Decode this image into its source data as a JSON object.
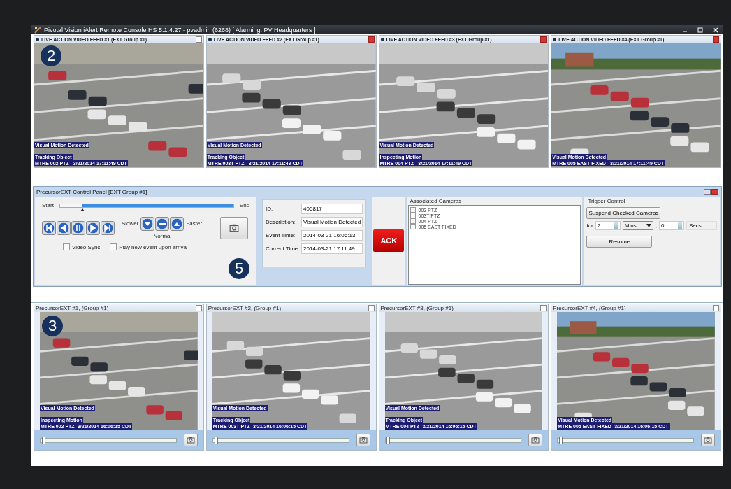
{
  "window": {
    "title": "Pivotal Vision iAlert Remote Console HS 5.1.4.27 - pvadmin (6268)  [ Alarming: PV Headquarters ]"
  },
  "live_feeds": {
    "badge": "2",
    "feeds": [
      {
        "title": "LIVE ACTION VIDEO FEED #1 (EXT Group #1)",
        "lines": [
          "Visual Motion Detected",
          "Tracking Object",
          "MTRE 002 PTZ - 3/21/2014 17:11:49 CDT"
        ]
      },
      {
        "title": "LIVE ACTION VIDEO FEED #2 (EXT Group #1)",
        "lines": [
          "Visual Motion Detected",
          "Tracking Object",
          "MTRE 003T PTZ - 3/21/2014 17:11:49 CDT"
        ]
      },
      {
        "title": "LIVE ACTION VIDEO FEED #3 (EXT Group #1)",
        "lines": [
          "Visual Motion Detected",
          "Inspecting Motion",
          "MTRE 004 PTZ - 3/21/2014 17:11:49 CDT"
        ]
      },
      {
        "title": "LIVE ACTION VIDEO FEED #4 (EXT Group #1)",
        "lines": [
          "Visual Motion Detected",
          "MTRE 005 EAST FIXED - 3/21/2014 17:11:49 CDT"
        ]
      }
    ]
  },
  "control_panel": {
    "title": "PrecursorEXT Control Panel [EXT Group #1]",
    "badge": "5",
    "timeline": {
      "start": "Start",
      "end": "End",
      "level": 0.13
    },
    "speed": {
      "slower": "Slower",
      "faster": "Faster",
      "normal": "Normal"
    },
    "options": [
      {
        "label": "Video Sync",
        "checked": false
      },
      {
        "label": "Play new event upon arrival",
        "checked": false
      }
    ],
    "event": [
      {
        "label": "ID:",
        "value": "405817"
      },
      {
        "label": "Description:",
        "value": "Visual Motion Detected"
      },
      {
        "label": "Event Time:",
        "value": "2014-03-21 16:06:13"
      },
      {
        "label": "Current Time:",
        "value": "2014-03-21 17:11:49"
      }
    ],
    "ack": "ACK",
    "associated_cameras": {
      "label": "Associated Cameras",
      "items": [
        {
          "label": "002 PTZ",
          "checked": false
        },
        {
          "label": "003T PTZ",
          "checked": false
        },
        {
          "label": "004 PTZ",
          "checked": false
        },
        {
          "label": "005 EAST FIXED",
          "checked": false
        }
      ]
    },
    "trigger": {
      "label": "Trigger Control",
      "suspend": "Suspend Checked Cameras",
      "for": "for",
      "minutes": "2",
      "unit": "Mins",
      "comma": ",",
      "seconds": "0",
      "seconds_unit": "Secs",
      "resume": "Resume"
    }
  },
  "precursor_feeds": {
    "badge": "3",
    "feeds": [
      {
        "title": "PrecursorEXT #1, (Group #1)",
        "lines": [
          "Visual Motion Detected",
          "Inspecting Motion",
          "MTRE 002 PTZ -3/21/2014 16:06:15 CDT"
        ],
        "level": 0.01
      },
      {
        "title": "PrecursorEXT #2, (Group #1)",
        "lines": [
          "Visual Motion Detected",
          "Tracking Object",
          "MTRE 003T PTZ -3/21/2014 16:06:15 CDT"
        ],
        "level": 0.01
      },
      {
        "title": "PrecursorEXT #3, (Group #1)",
        "lines": [
          "Visual Motion Detected",
          "Tracking Object",
          "MTRE 004 PTZ -3/21/2014 16:06:15 CDT"
        ],
        "level": 0.01
      },
      {
        "title": "PrecursorEXT #4, (Group #1)",
        "lines": [
          "Visual Motion Detected",
          "MTRE 005 EAST FIXED -3/21/2014 16:06:15 CDT"
        ],
        "level": 0.01
      }
    ]
  }
}
